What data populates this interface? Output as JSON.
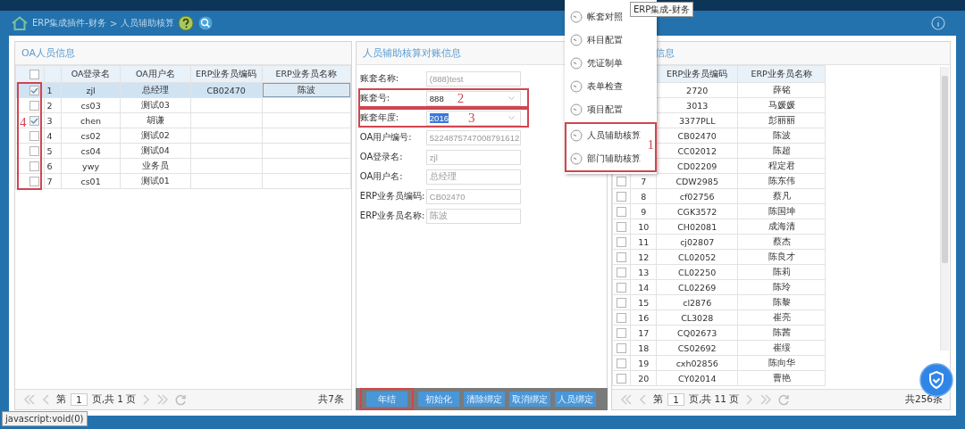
{
  "breadcrumb": {
    "path": "ERP集成插件-财务",
    "separator": ">",
    "current": "人员辅助核算"
  },
  "tooltip": "ERP集成-财务",
  "menu": {
    "annotation": "1",
    "items": [
      {
        "label": "帐套对照",
        "annotated": false
      },
      {
        "label": "科目配置",
        "annotated": false
      },
      {
        "label": "凭证制单",
        "annotated": false
      },
      {
        "label": "表单检查",
        "annotated": false
      },
      {
        "label": "项目配置",
        "annotated": false
      },
      {
        "label": "人员辅助核算",
        "annotated": true
      },
      {
        "label": "部门辅助核算",
        "annotated": true
      }
    ]
  },
  "oa_panel": {
    "title": "OA人员信息",
    "all_checked": false,
    "annotation": "4",
    "columns": [
      "OA登录名",
      "OA用户名",
      "ERP业务员编码",
      "ERP业务员名称"
    ],
    "rows": [
      {
        "no": "1",
        "login": "zjl",
        "user": "总经理",
        "erp_code": "CB02470",
        "erp_name": "陈波",
        "checked": true,
        "selected": true
      },
      {
        "no": "2",
        "login": "cs03",
        "user": "测试03",
        "checked": false,
        "selected": false
      },
      {
        "no": "3",
        "login": "chen",
        "user": "胡谦",
        "checked": true,
        "selected": false
      },
      {
        "no": "4",
        "login": "cs02",
        "user": "测试02",
        "checked": false,
        "selected": false
      },
      {
        "no": "5",
        "login": "cs04",
        "user": "测试04",
        "checked": false,
        "selected": false
      },
      {
        "no": "6",
        "login": "ywy",
        "user": "业务员",
        "checked": false,
        "selected": false
      },
      {
        "no": "7",
        "login": "cs01",
        "user": "测试01",
        "checked": false,
        "selected": false
      }
    ],
    "pager": {
      "prefix": "第",
      "page": "1",
      "suffix": "页,共 1 页",
      "total": "共7条"
    }
  },
  "form_panel": {
    "title": "人员辅助核算对账信息",
    "fields": [
      {
        "label": "账套名称:",
        "value": "(888)test",
        "kind": "text",
        "disabled": true,
        "text_selected": false
      },
      {
        "label": "账套号:",
        "value": "888",
        "kind": "select",
        "disabled": false,
        "text_selected": false,
        "annotation": "2"
      },
      {
        "label": "账套年度:",
        "value": "2016",
        "kind": "select",
        "disabled": false,
        "text_selected": true,
        "annotation": "3"
      },
      {
        "label": "OA用户编号:",
        "value": "5224875747008791612",
        "kind": "text",
        "disabled": true,
        "text_selected": false
      },
      {
        "label": "OA登录名:",
        "value": "zjl",
        "kind": "text",
        "disabled": true,
        "text_selected": false
      },
      {
        "label": "OA用户名:",
        "value": "总经理",
        "kind": "text",
        "disabled": true,
        "text_selected": false
      },
      {
        "label": "ERP业务员编码:",
        "value": "CB02470",
        "kind": "text",
        "disabled": true,
        "text_selected": false
      },
      {
        "label": "ERP业务员名称:",
        "value": "陈波",
        "kind": "text",
        "disabled": true,
        "text_selected": false
      }
    ],
    "buttons": [
      {
        "label": "年结",
        "highlighted": true
      },
      {
        "label": "初始化",
        "highlighted": false
      },
      {
        "label": "清除绑定",
        "highlighted": false
      },
      {
        "label": "取消绑定",
        "highlighted": false
      },
      {
        "label": "人员绑定",
        "highlighted": false
      }
    ]
  },
  "erp_panel": {
    "title": "信息",
    "columns": [
      "ERP业务员编码",
      "ERP业务员名称"
    ],
    "rows": [
      {
        "code": "2720",
        "name": "薛铭"
      },
      {
        "code": "3013",
        "name": "马媛媛"
      },
      {
        "code": "3377PLL",
        "name": "彭丽丽"
      },
      {
        "code": "CB02470",
        "name": "陈波"
      },
      {
        "code": "CC02012",
        "name": "陈超"
      },
      {
        "code": "CD02209",
        "name": "程定君"
      },
      {
        "no": "7",
        "code": "CDW2985",
        "name": "陈东伟",
        "checked": false
      },
      {
        "no": "8",
        "code": "cf02756",
        "name": "蔡凡",
        "checked": false
      },
      {
        "no": "9",
        "code": "CGK3572",
        "name": "陈国坤",
        "checked": false
      },
      {
        "no": "10",
        "code": "CH02081",
        "name": "成海清",
        "checked": false
      },
      {
        "no": "11",
        "code": "cj02807",
        "name": "蔡杰",
        "checked": false
      },
      {
        "no": "12",
        "code": "CL02052",
        "name": "陈良才",
        "checked": false
      },
      {
        "no": "13",
        "code": "CL02250",
        "name": "陈莉",
        "checked": false
      },
      {
        "no": "14",
        "code": "CL02269",
        "name": "陈玲",
        "checked": false
      },
      {
        "no": "15",
        "code": "cl2876",
        "name": "陈黎",
        "checked": false
      },
      {
        "no": "16",
        "code": "CL3028",
        "name": "崔亮",
        "checked": false
      },
      {
        "no": "17",
        "code": "CQ02673",
        "name": "陈茜",
        "checked": false
      },
      {
        "no": "18",
        "code": "CS02692",
        "name": "崔绥",
        "checked": false
      },
      {
        "no": "19",
        "code": "cxh02856",
        "name": "陈向华",
        "checked": false
      },
      {
        "no": "20",
        "code": "CY02014",
        "name": "曹艳",
        "checked": false
      }
    ],
    "pager": {
      "prefix": "第",
      "page": "1",
      "suffix": "页,共 11 页",
      "total": "共256条"
    }
  },
  "status_text": "javascript:void(0)"
}
